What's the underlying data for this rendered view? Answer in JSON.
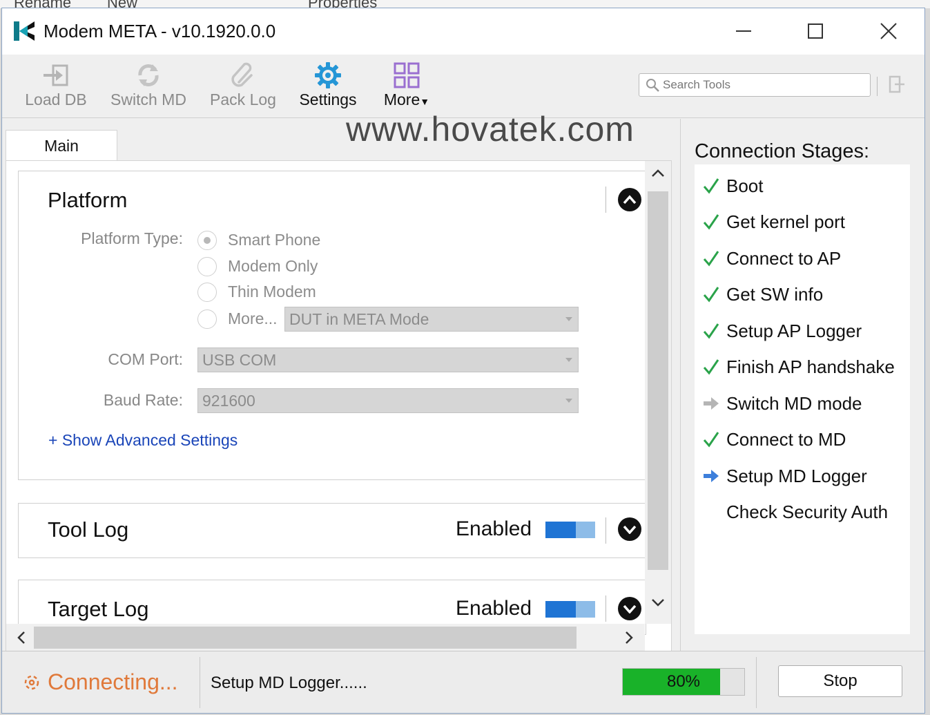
{
  "background_window": {
    "menu_items": [
      "Rename",
      "New",
      "Properties"
    ]
  },
  "window": {
    "title": "Modem META - v10.1920.0.0",
    "controls": {
      "minimize": "minimize-icon",
      "maximize": "maximize-icon",
      "close": "close-icon"
    }
  },
  "toolbar": {
    "buttons": [
      {
        "label": "Load DB",
        "icon": "load-db-icon",
        "enabled": false
      },
      {
        "label": "Switch MD",
        "icon": "switch-md-icon",
        "enabled": false
      },
      {
        "label": "Pack Log",
        "icon": "paperclip-icon",
        "enabled": false
      },
      {
        "label": "Settings",
        "icon": "gear-icon",
        "enabled": true
      },
      {
        "label": "More",
        "icon": "grid-icon",
        "enabled": true
      }
    ],
    "search_placeholder": "Search Tools"
  },
  "watermark": "www.hovatek.com",
  "tabs": [
    {
      "label": "Main",
      "active": true
    }
  ],
  "platform": {
    "title": "Platform",
    "type_label": "Platform Type:",
    "options": [
      "Smart Phone",
      "Modem Only",
      "Thin Modem",
      "More..."
    ],
    "selected_option": "Smart Phone",
    "more_value": "DUT in META Mode",
    "com_port_label": "COM Port:",
    "com_port_value": "USB COM",
    "baud_rate_label": "Baud Rate:",
    "baud_rate_value": "921600",
    "advanced_link": "+ Show Advanced Settings"
  },
  "tool_log": {
    "title": "Tool Log",
    "status": "Enabled",
    "enabled": true
  },
  "target_log": {
    "title": "Target Log",
    "status": "Enabled",
    "enabled": true
  },
  "connection_stages": {
    "title": "Connection Stages:",
    "stages": [
      {
        "label": "Boot",
        "status": "done"
      },
      {
        "label": "Get kernel port",
        "status": "done"
      },
      {
        "label": "Connect to AP",
        "status": "done"
      },
      {
        "label": "Get SW info",
        "status": "done"
      },
      {
        "label": "Setup AP Logger",
        "status": "done"
      },
      {
        "label": "Finish AP handshake",
        "status": "done"
      },
      {
        "label": "Switch MD mode",
        "status": "skipped"
      },
      {
        "label": "Connect to MD",
        "status": "done"
      },
      {
        "label": "Setup MD Logger",
        "status": "current"
      },
      {
        "label": "Check Security Auth",
        "status": "pending"
      }
    ]
  },
  "status_bar": {
    "state": "Connecting...",
    "message": "Setup MD Logger......",
    "progress_value": 0.8,
    "progress_text": "80%",
    "stop_label": "Stop"
  },
  "colors": {
    "accent_blue": "#1f74d4",
    "progress_green": "#19b229",
    "connecting_orange": "#e0793a",
    "check_green": "#2aa34a"
  }
}
